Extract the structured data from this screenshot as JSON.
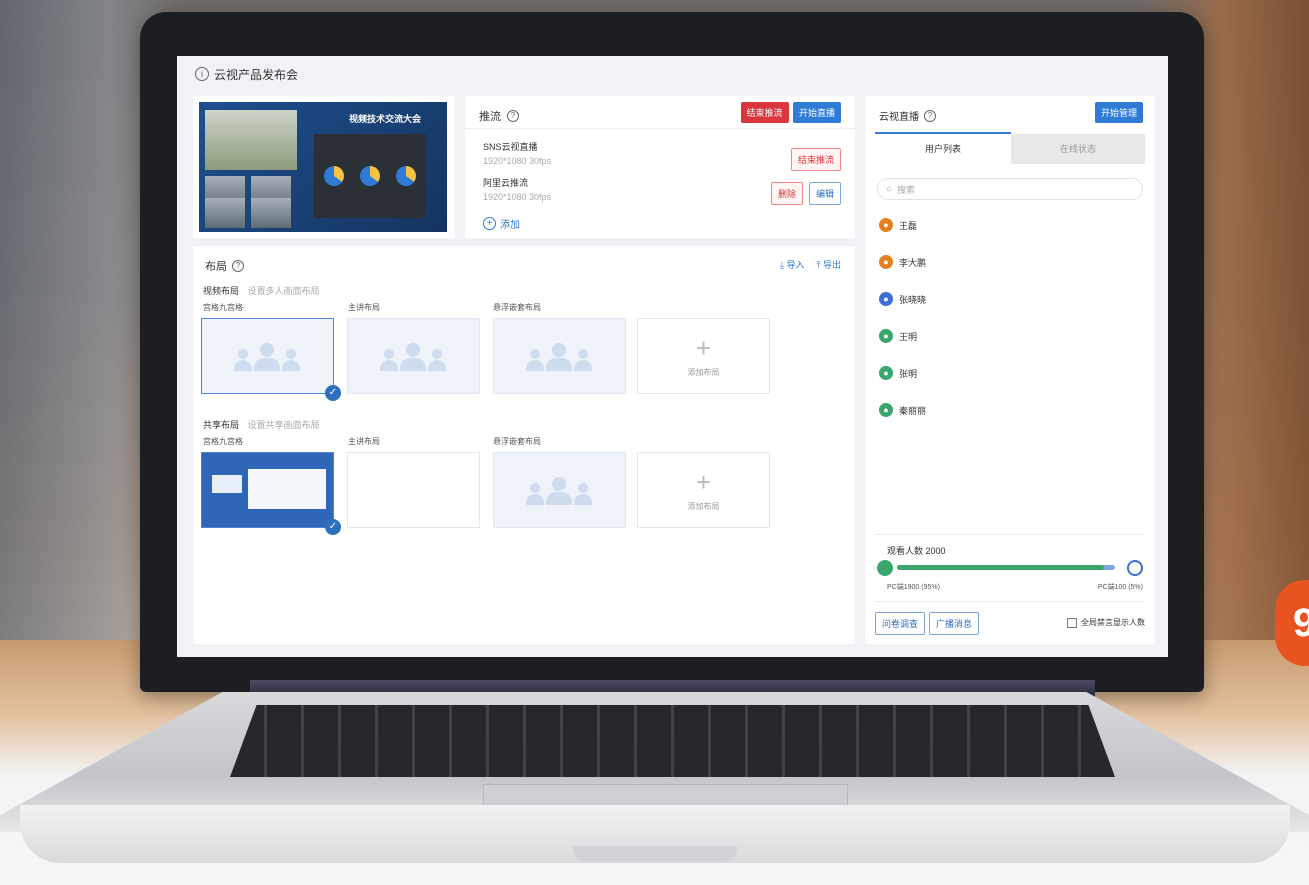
{
  "app": {
    "title": "云视产品发布会"
  },
  "preview": {
    "heading": "视频技术交流大会"
  },
  "stream": {
    "title": "推流",
    "end_button": "结束推流",
    "start_button": "开始直播",
    "items": [
      {
        "name": "SNS云视直播",
        "spec": "1920*1080 30fps",
        "actions": [
          "结束推流"
        ]
      },
      {
        "name": "阿里云推流",
        "spec": "1920*1080 30fps",
        "actions": [
          "删除",
          "编辑"
        ]
      }
    ],
    "add_label": "添加"
  },
  "layout": {
    "title": "布局",
    "import_label": "导入",
    "export_label": "导出",
    "groups": [
      {
        "name": "视频布局",
        "hint": "设置多人画面布局",
        "cards": [
          {
            "label": "宫格九宫格",
            "selected": true
          },
          {
            "label": "主讲布局",
            "selected": false
          },
          {
            "label": "悬浮嵌套布局",
            "selected": false
          }
        ]
      },
      {
        "name": "共享布局",
        "hint": "设置共享画面布局",
        "cards": [
          {
            "label": "宫格九宫格",
            "selected": true
          },
          {
            "label": "主讲布局",
            "selected": false
          },
          {
            "label": "悬浮嵌套布局",
            "selected": false
          }
        ]
      }
    ],
    "add_layout_label": "添加布局"
  },
  "viewer": {
    "title": "云视直播",
    "manage_button": "开始管理",
    "tabs": [
      "用户列表",
      "在线状态"
    ],
    "search_placeholder": "搜索",
    "users": [
      {
        "name": "王磊",
        "color": "#e67e22",
        "icon": "user-icon"
      },
      {
        "name": "李大鹏",
        "color": "#e67e22",
        "icon": "user-icon"
      },
      {
        "name": "张晓晓",
        "color": "#3b6fd6",
        "icon": "user-icon"
      },
      {
        "name": "王明",
        "color": "#3aa66c",
        "icon": "user-icon"
      },
      {
        "name": "张明",
        "color": "#3aa66c",
        "icon": "user-icon"
      },
      {
        "name": "秦丽丽",
        "color": "#3aa66c",
        "icon": "user-icon"
      }
    ],
    "total_label": "观看人数 2000",
    "progress_fraction": 0.95,
    "left_stat": "PC端1900 (95%)",
    "right_stat": "PC端100 (5%)",
    "action_buttons": [
      "问卷调查",
      "广播消息"
    ],
    "checkbox_label": "全局禁言显示人数"
  },
  "colors": {
    "accent": "#2f7bd6",
    "danger": "#d9363e",
    "success": "#3aa66c"
  }
}
